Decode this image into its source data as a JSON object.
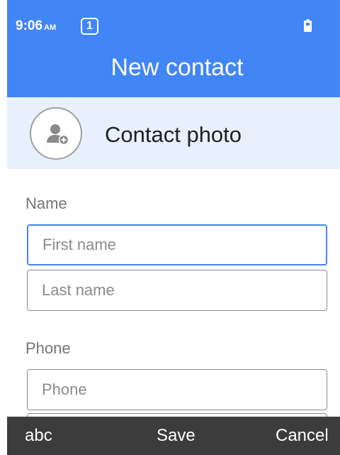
{
  "status_bar": {
    "time": "9:06",
    "ampm": "AM",
    "notification_count": "1",
    "battery_icon": "battery-icon"
  },
  "app_bar": {
    "title": "New contact"
  },
  "photo_section": {
    "label": "Contact photo",
    "icon": "add-contact-photo-icon"
  },
  "name_section": {
    "label": "Name",
    "first_name": {
      "placeholder": "First name",
      "value": ""
    },
    "last_name": {
      "placeholder": "Last name",
      "value": ""
    }
  },
  "phone_section": {
    "label": "Phone",
    "phone": {
      "placeholder": "Phone",
      "value": ""
    }
  },
  "softkeys": {
    "left": "abc",
    "center": "Save",
    "right": "Cancel"
  },
  "colors": {
    "header_blue": "#4285f4",
    "photo_row_bg": "#e8f0fe",
    "softkey_bar": "#3c3c3c",
    "focus_border": "#4285f4"
  }
}
